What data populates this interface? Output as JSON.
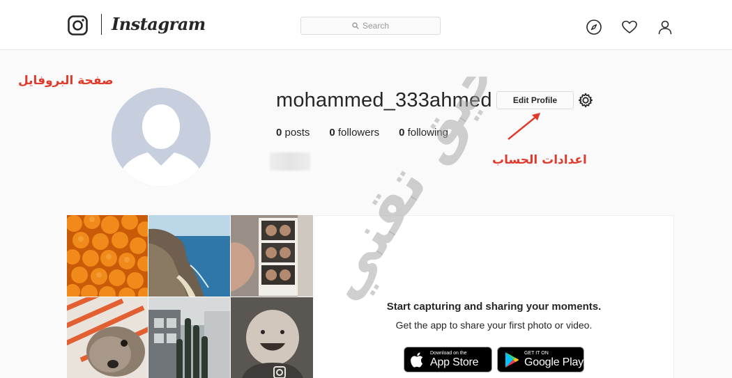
{
  "nav": {
    "brand": "Instagram",
    "search_placeholder": "Search",
    "icons": [
      "instagram-logo-icon",
      "search-icon",
      "compass-icon",
      "heart-icon",
      "user-icon"
    ]
  },
  "profile": {
    "username": "mohammed_333ahmed",
    "edit_label": "Edit Profile",
    "stats": [
      {
        "count": "0",
        "label": "posts"
      },
      {
        "count": "0",
        "label": "followers"
      },
      {
        "count": "0",
        "label": "following"
      }
    ]
  },
  "annotations": {
    "profile_page": "صفحة البروفايل",
    "account_settings": "اعدادات الحساب",
    "watermark": "حيق تقني"
  },
  "onboarding": {
    "title": "Start capturing and sharing your moments.",
    "subtitle": "Get the app to share your first photo or video.",
    "app_store": {
      "small": "Download on the",
      "big": "App Store"
    },
    "google_play": {
      "small": "GET IT ON",
      "big": "Google Play"
    }
  },
  "colors": {
    "annotation": "#e03a2b",
    "avatar_bg": "#c7cfdf",
    "border": "#dbdbdb"
  }
}
